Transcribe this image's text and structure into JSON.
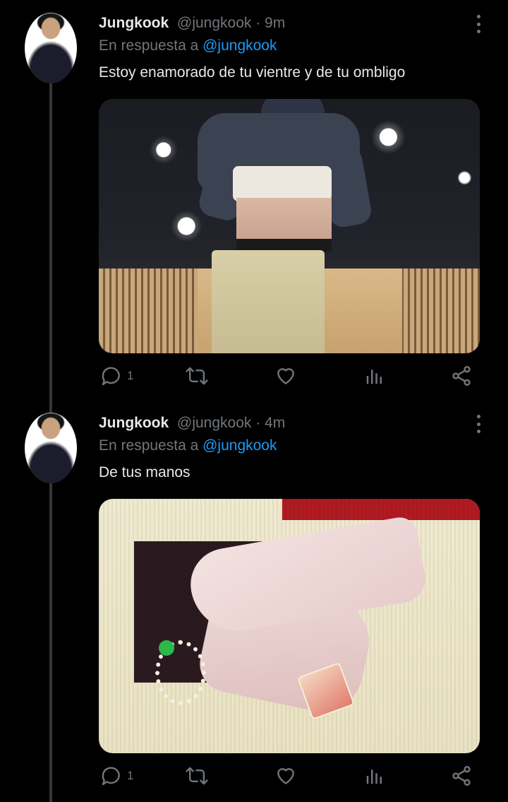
{
  "tweets": [
    {
      "author": "Jungkook",
      "handle": "@jungkook",
      "time": "· 9m",
      "reply_prefix": "En respuesta a",
      "reply_mention": "@jungkook",
      "text": "Estoy enamorado de tu vientre y de tu ombligo",
      "reply_count": "1"
    },
    {
      "author": "Jungkook",
      "handle": "@jungkook",
      "time": "· 4m",
      "reply_prefix": "En respuesta a",
      "reply_mention": "@jungkook",
      "text": "De tus manos",
      "reply_count": "1"
    }
  ],
  "icons": [
    "more-options-icon",
    "reply-icon",
    "retweet-icon",
    "like-icon",
    "analytics-icon",
    "share-icon"
  ],
  "colors": {
    "background": "#000000",
    "text": "#e7e9ea",
    "muted": "#71767b",
    "mention": "#1d9bf0",
    "thread_line": "#333639"
  }
}
